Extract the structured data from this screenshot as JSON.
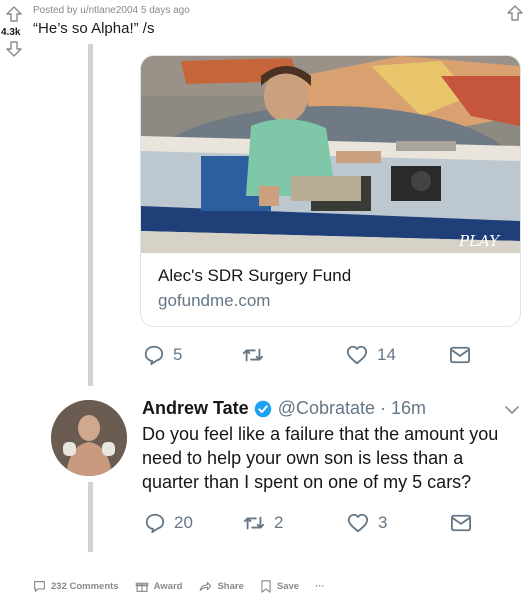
{
  "post": {
    "score": "4.3k",
    "meta": "Posted by u/ntlane2004 5 days ago",
    "title": "“He’s so Alpha!” /s"
  },
  "link_tweet": {
    "card_title": "Alec's SDR Surgery Fund",
    "card_domain": "gofundme.com",
    "card_image_text": "PLAY",
    "replies": "5",
    "retweets": "",
    "likes": "14"
  },
  "reply_tweet": {
    "name": "Andrew Tate",
    "handle": "@Cobratate · 16m",
    "text": "Do you feel like a failure that the amount you need to help your own son is less than a quarter than I spent on one of my 5 cars?",
    "replies": "20",
    "retweets": "2",
    "likes": "3"
  },
  "footer": {
    "comments": "232 Comments",
    "award": "Award",
    "share": "Share",
    "save": "Save",
    "more": "···"
  },
  "colors": {
    "twitter_gray": "#657786",
    "verified_blue": "#1da1f2",
    "reddit_gray": "#878a8c"
  }
}
